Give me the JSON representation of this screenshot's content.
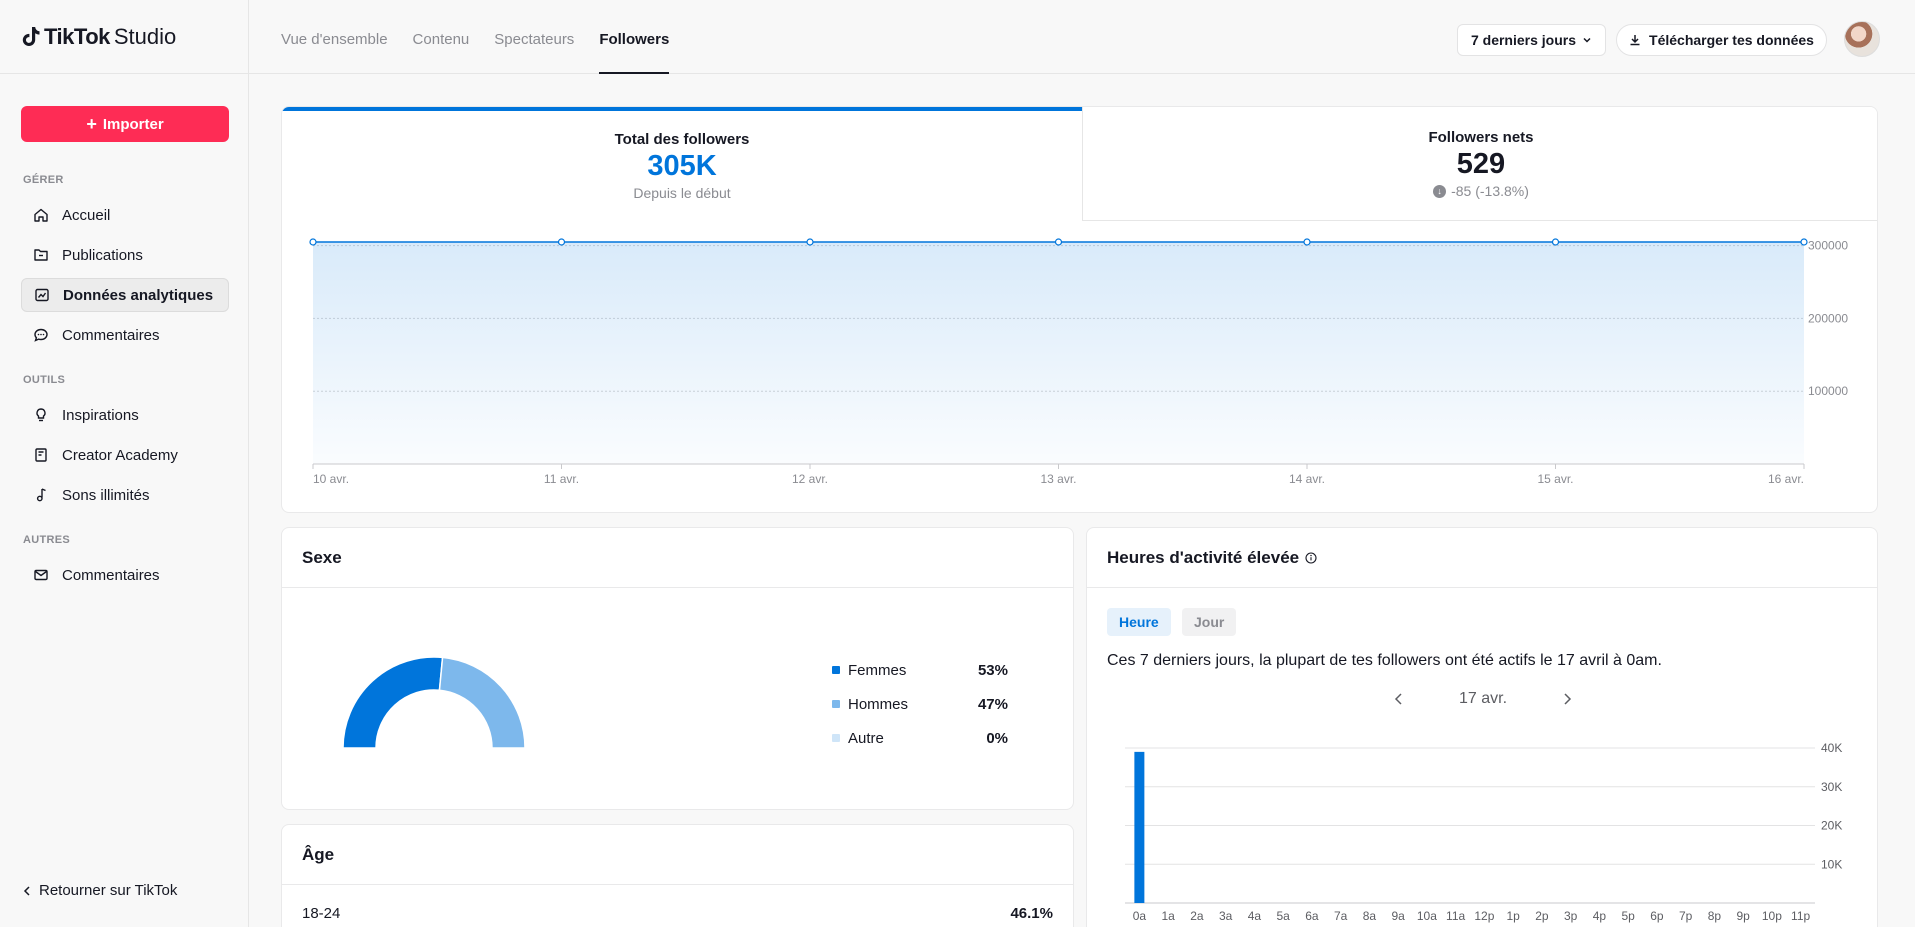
{
  "header": {
    "logo_brand": "TikTok",
    "logo_sub": "Studio",
    "tabs": [
      {
        "label": "Vue d'ensemble",
        "active": false
      },
      {
        "label": "Contenu",
        "active": false
      },
      {
        "label": "Spectateurs",
        "active": false
      },
      {
        "label": "Followers",
        "active": true
      }
    ],
    "period": "7 derniers jours",
    "download": "Télécharger tes données"
  },
  "sidebar": {
    "import_label": "Importer",
    "sections": {
      "manage": "GÉRER",
      "tools": "OUTILS",
      "others": "AUTRES"
    },
    "items": [
      {
        "label": "Accueil",
        "icon": "home-icon"
      },
      {
        "label": "Publications",
        "icon": "folder-icon"
      },
      {
        "label": "Données analytiques",
        "icon": "analytics-icon",
        "active": true
      },
      {
        "label": "Commentaires",
        "icon": "comment-icon"
      },
      {
        "label": "Inspirations",
        "icon": "lightbulb-icon"
      },
      {
        "label": "Creator Academy",
        "icon": "book-icon"
      },
      {
        "label": "Sons illimités",
        "icon": "music-icon"
      },
      {
        "label": "Commentaires",
        "icon": "mail-icon"
      }
    ],
    "back_label": "Retourner sur TikTok"
  },
  "metrics": {
    "total": {
      "label": "Total des followers",
      "value": "305K",
      "sub": "Depuis le début"
    },
    "net": {
      "label": "Followers nets",
      "value": "529",
      "sub": "-85 (-13.8%)"
    }
  },
  "line_chart": {
    "type": "area",
    "x": [
      "10 avr.",
      "11 avr.",
      "12 avr.",
      "13 avr.",
      "14 avr.",
      "15 avr.",
      "16 avr."
    ],
    "values": [
      305000,
      305000,
      305000,
      305000,
      305000,
      305000,
      305000
    ],
    "yticks": [
      "300000",
      "200000",
      "100000"
    ],
    "ylim": [
      0,
      305000
    ],
    "color": "#0075db"
  },
  "sexe": {
    "title": "Sexe",
    "entries": [
      {
        "name": "Femmes",
        "pct": "53%",
        "value": 53,
        "color": "#0075db"
      },
      {
        "name": "Hommes",
        "pct": "47%",
        "value": 47,
        "color": "#7db8ec"
      },
      {
        "name": "Autre",
        "pct": "0%",
        "value": 0,
        "color": "#cfe5f8"
      }
    ]
  },
  "age": {
    "title": "Âge",
    "first_row": {
      "label": "18-24",
      "pct": "46.1%"
    }
  },
  "activity": {
    "title": "Heures d'activité élevée",
    "toggle_hour": "Heure",
    "toggle_day": "Jour",
    "summary": "Ces 7 derniers jours, la plupart de tes followers ont été actifs le 17 avril à 0am.",
    "date": "17 avr."
  },
  "chart_data": {
    "type": "bar",
    "categories": [
      "0a",
      "1a",
      "2a",
      "3a",
      "4a",
      "5a",
      "6a",
      "7a",
      "8a",
      "9a",
      "10a",
      "11a",
      "12p",
      "1p",
      "2p",
      "3p",
      "4p",
      "5p",
      "6p",
      "7p",
      "8p",
      "9p",
      "10p",
      "11p"
    ],
    "values": [
      39000,
      0,
      0,
      0,
      0,
      0,
      0,
      0,
      0,
      0,
      0,
      0,
      0,
      0,
      0,
      0,
      0,
      0,
      0,
      0,
      0,
      0,
      0,
      0
    ],
    "yticks": [
      "40K",
      "30K",
      "20K",
      "10K"
    ],
    "ylim": [
      0,
      40000
    ],
    "color": "#0075db"
  }
}
